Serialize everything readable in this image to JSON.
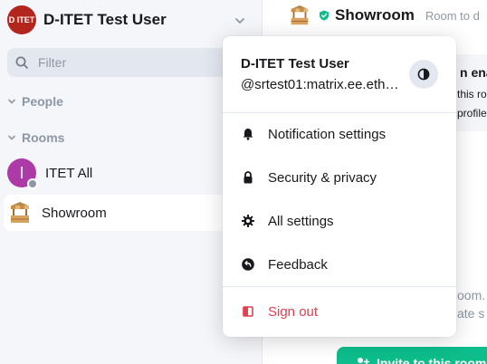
{
  "sidebar": {
    "user": {
      "initials": "D ITET",
      "name": "D-ITET Test User"
    },
    "filter": {
      "placeholder": "Filter"
    },
    "sections": {
      "people": "People",
      "rooms": "Rooms"
    },
    "rooms": [
      {
        "initial": "I",
        "label": "ITET All"
      },
      {
        "label": "Showroom",
        "active": true
      }
    ]
  },
  "room": {
    "title": "Showroom",
    "topic": "Room to d",
    "notice_title": "n ena",
    "notice_line1": "this ro",
    "notice_line2": "profile,",
    "bg_line1": "oom. T",
    "bg_line2": "ate s",
    "invite_label": "Invite to this room"
  },
  "menu": {
    "name": "D-ITET Test User",
    "user_id": "@srtest01:matrix.ee.ethz.ch",
    "items": [
      {
        "label": "Notification settings",
        "icon": "bell-icon"
      },
      {
        "label": "Security & privacy",
        "icon": "lock-icon"
      },
      {
        "label": "All settings",
        "icon": "gear-icon"
      },
      {
        "label": "Feedback",
        "icon": "feedback-icon"
      }
    ],
    "sign_out": "Sign out"
  },
  "colors": {
    "accent": "#0dbd8b",
    "danger": "#e0404f",
    "user_avatar": "#b3261e",
    "itet_avatar": "#ac3ba8",
    "sidebar_bg": "#f4f6fa"
  }
}
